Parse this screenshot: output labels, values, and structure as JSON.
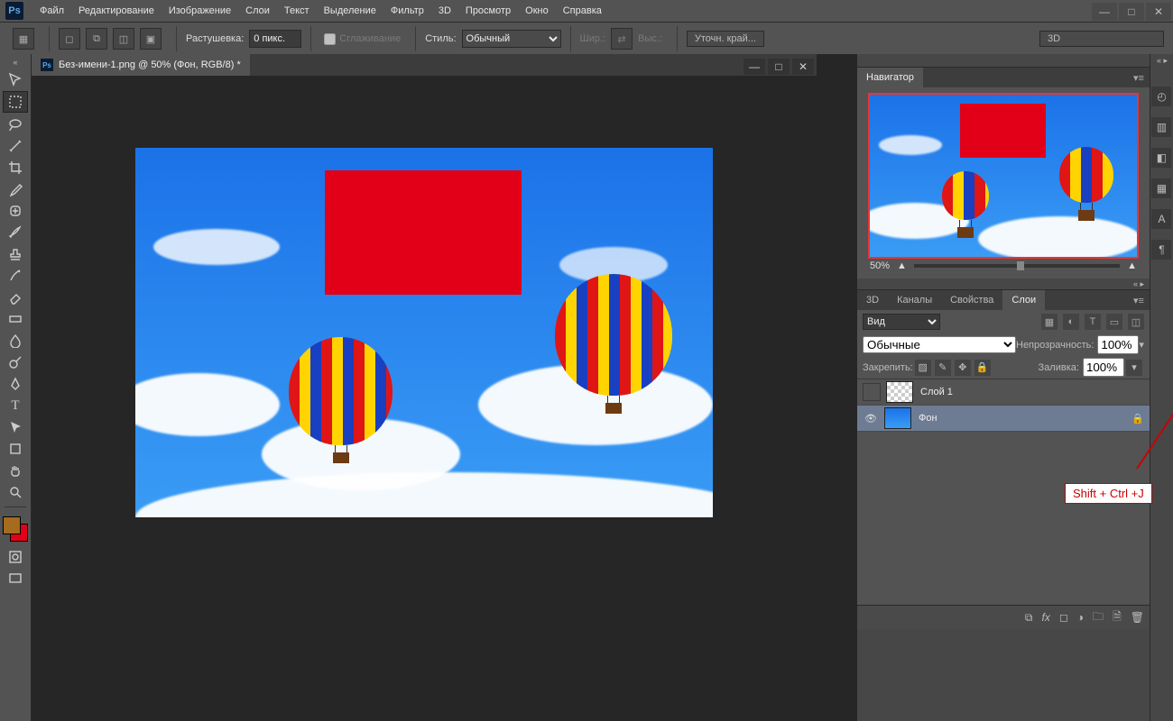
{
  "menubar": {
    "items": [
      "Файл",
      "Редактирование",
      "Изображение",
      "Слои",
      "Текст",
      "Выделение",
      "Фильтр",
      "3D",
      "Просмотр",
      "Окно",
      "Справка"
    ]
  },
  "optionsbar": {
    "feather_label": "Растушевка:",
    "feather_value": "0 пикс.",
    "antialias_label": "Сглаживание",
    "style_label": "Стиль:",
    "style_value": "Обычный",
    "width_label": "Шир.:",
    "height_label": "Выс.:",
    "refine_label": "Уточн. край...",
    "mode3d": "3D"
  },
  "document": {
    "tab_title": "Без-имени-1.png @ 50% (Фон, RGB/8) *"
  },
  "navigator": {
    "tab": "Навигатор",
    "zoom": "50%"
  },
  "layerspanel": {
    "tabs": [
      "3D",
      "Каналы",
      "Свойства",
      "Слои"
    ],
    "kind_label": "Вид",
    "blend": "Обычные",
    "opacity_label": "Непрозрачность:",
    "opacity_value": "100%",
    "lock_label": "Закрепить:",
    "fill_label": "Заливка:",
    "fill_value": "100%",
    "layers": [
      {
        "name": "Слой 1",
        "visible": false,
        "locked": false,
        "thumb": "chk"
      },
      {
        "name": "Фон",
        "visible": true,
        "locked": true,
        "thumb": "sky"
      }
    ]
  },
  "swatches": {
    "fg": "#a56b1e",
    "bg": "#e10018"
  },
  "annotation": {
    "text": "Shift + Ctrl +J"
  }
}
